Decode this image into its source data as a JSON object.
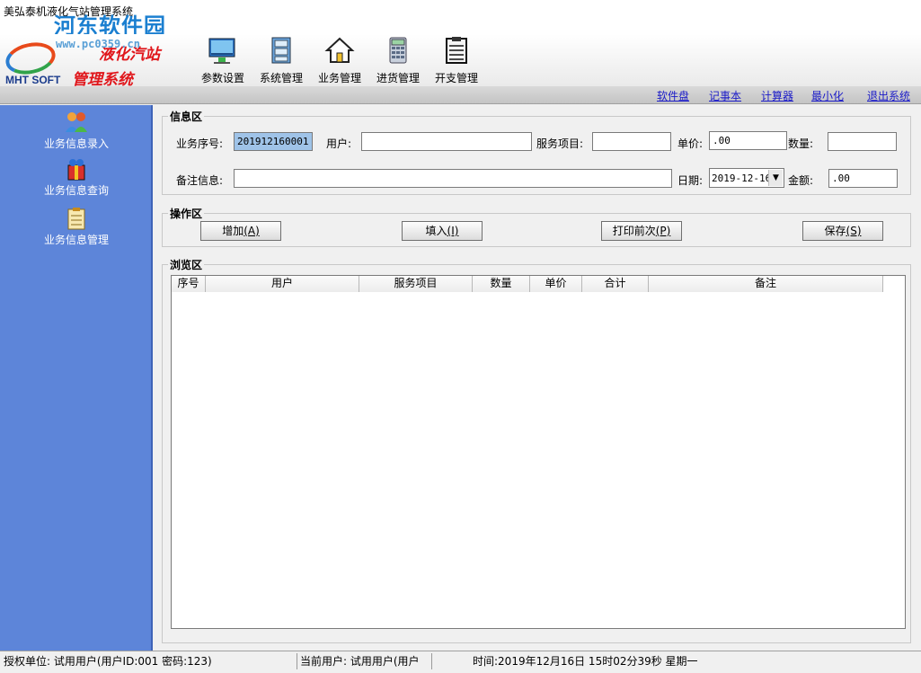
{
  "window": {
    "title": "美弘泰机液化气站管理系统",
    "watermark": "河东软件园",
    "watermark_url": "www.pc0359.cn"
  },
  "logo": {
    "title_line1": "液化汽站",
    "title_line2": "管理系统",
    "brand": "MHT SOFT"
  },
  "toolbar": {
    "items": [
      {
        "label": "参数设置",
        "icon": "settings-screen-icon"
      },
      {
        "label": "系统管理",
        "icon": "cabinet-icon"
      },
      {
        "label": "业务管理",
        "icon": "home-icon"
      },
      {
        "label": "进货管理",
        "icon": "calculator-icon"
      },
      {
        "label": "开支管理",
        "icon": "clipboard-icon"
      }
    ]
  },
  "links": [
    "软件盘",
    "记事本",
    "计算器",
    "最小化",
    "退出系统"
  ],
  "sidebar": {
    "items": [
      {
        "label": "业务信息录入",
        "icon": "users-icon"
      },
      {
        "label": "业务信息查询",
        "icon": "gift-icon"
      },
      {
        "label": "业务信息管理",
        "icon": "clipboard-icon"
      }
    ]
  },
  "info": {
    "legend": "信息区",
    "serial_label": "业务序号:",
    "serial_value": "201912160001",
    "user_label": "用户:",
    "user_value": "",
    "service_label": "服务项目:",
    "service_value": "",
    "price_label": "单价:",
    "price_value": ".00",
    "qty_label": "数量:",
    "qty_value": "",
    "note_label": "备注信息:",
    "note_value": "",
    "date_label": "日期:",
    "date_value": "2019-12-16",
    "amount_label": "金额:",
    "amount_value": ".00"
  },
  "ops": {
    "legend": "操作区",
    "add": {
      "text": "增加",
      "key": "(A)"
    },
    "fill": {
      "text": "填入",
      "key": "(I)"
    },
    "print": {
      "text": "打印前次",
      "key": "(P)"
    },
    "save": {
      "text": "保存",
      "key": "(S)"
    }
  },
  "browse": {
    "legend": "浏览区",
    "columns": [
      "序号",
      "用户",
      "服务项目",
      "数量",
      "单价",
      "合计",
      "备注"
    ]
  },
  "status": {
    "auth": "授权单位: 试用用户(用户ID:001 密码:123)",
    "current_user": "当前用户: 试用用户(用户",
    "time": "时间:2019年12月16日 15时02分39秒 星期一"
  },
  "colors": {
    "sidebar": "#5d85d9",
    "link": "#1a1ac8",
    "logo_red": "#e0161b",
    "selected_input": "#9fc3e8"
  }
}
